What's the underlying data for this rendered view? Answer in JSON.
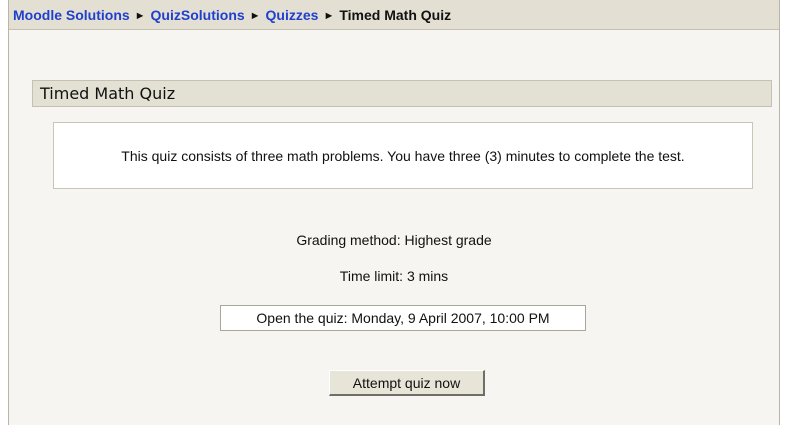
{
  "breadcrumb": {
    "items": [
      {
        "label": "Moodle Solutions"
      },
      {
        "label": "QuizSolutions"
      },
      {
        "label": "Quizzes"
      }
    ],
    "separator": "►",
    "current": "Timed Math Quiz"
  },
  "quiz": {
    "title": "Timed Math Quiz",
    "intro": "This quiz consists of three math problems. You have three (3) minutes to complete the test.",
    "grading_method": "Grading method: Highest grade",
    "time_limit": "Time limit: 3 mins",
    "open_date": "Open the quiz: Monday, 9 April 2007, 10:00 PM",
    "attempt_button_label": "Attempt quiz now"
  }
}
